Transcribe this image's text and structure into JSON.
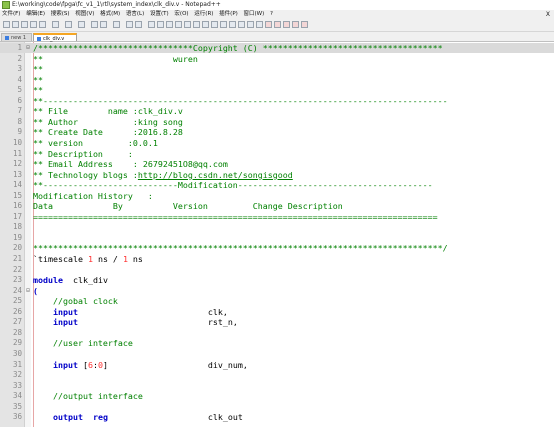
{
  "window": {
    "title": "E:\\working\\code\\fpga\\fc_v1_1\\rtl\\system_index\\clk_div.v - Notepad++",
    "close_glyph": "X"
  },
  "menu": [
    "文件(F)",
    "编辑(E)",
    "搜索(S)",
    "视图(V)",
    "格式(M)",
    "语言(L)",
    "设置(T)",
    "宏(O)",
    "运行(R)",
    "插件(P)",
    "窗口(W)",
    "?"
  ],
  "tabs": [
    {
      "label": "new 1"
    },
    {
      "label": "clk_div.v"
    }
  ],
  "toolbar_icons": [
    "new-file-icon",
    "open-file-icon",
    "save-icon",
    "save-all-icon",
    "close-icon",
    "close-all-icon",
    "print-icon",
    "cut-icon",
    "copy-icon",
    "paste-icon",
    "undo-icon",
    "redo-icon",
    "find-icon",
    "replace-icon",
    "zoom-in-icon",
    "zoom-out-icon",
    "sync-v-icon",
    "sync-h-icon",
    "wrap-icon",
    "show-all-icon",
    "indent-guide-icon",
    "udl-icon",
    "doc-map-icon",
    "function-list-icon",
    "folder-workspace-icon",
    "monitor-icon",
    "record-macro-icon",
    "stop-macro-icon",
    "play-macro-icon",
    "run-macro-icon",
    "save-macro-icon"
  ],
  "lines": [
    {
      "n": "1",
      "fold": "⊟",
      "tokens": [
        {
          "t": "/*******************************Copyright (C) ************************************",
          "c": "c"
        }
      ]
    },
    {
      "n": "2",
      "tokens": [
        {
          "t": "**                          wuren",
          "c": "c"
        }
      ]
    },
    {
      "n": "3",
      "tokens": [
        {
          "t": "**",
          "c": "c"
        }
      ]
    },
    {
      "n": "4",
      "tokens": [
        {
          "t": "**",
          "c": "c"
        }
      ]
    },
    {
      "n": "5",
      "tokens": [
        {
          "t": "**",
          "c": "c"
        }
      ]
    },
    {
      "n": "6",
      "tokens": [
        {
          "t": "**---------------------------------------------------------------------------------",
          "c": "c"
        }
      ]
    },
    {
      "n": "7",
      "tokens": [
        {
          "t": "** File        name :clk_div.v",
          "c": "c"
        }
      ]
    },
    {
      "n": "8",
      "tokens": [
        {
          "t": "** Author           :king song",
          "c": "c"
        }
      ]
    },
    {
      "n": "9",
      "tokens": [
        {
          "t": "** Create Date      :2016.8.28",
          "c": "c"
        }
      ]
    },
    {
      "n": "10",
      "tokens": [
        {
          "t": "** version         :0.0.1",
          "c": "c"
        }
      ]
    },
    {
      "n": "11",
      "tokens": [
        {
          "t": "** Description     :",
          "c": "c"
        }
      ]
    },
    {
      "n": "12",
      "tokens": [
        {
          "t": "** Email Address    : 26792451O8@qq.com",
          "c": "c"
        }
      ]
    },
    {
      "n": "13",
      "tokens": [
        {
          "t": "** Technology blogs :",
          "c": "c"
        },
        {
          "t": "http://blog.csdn.net/songisgood",
          "c": "c u"
        }
      ]
    },
    {
      "n": "14",
      "tokens": [
        {
          "t": "**---------------------------Modification---------------------------------------",
          "c": "c"
        }
      ]
    },
    {
      "n": "15",
      "tokens": [
        {
          "t": "Modification History   :",
          "c": "c"
        }
      ]
    },
    {
      "n": "16",
      "tokens": [
        {
          "t": "Data            By          Version         Change Description",
          "c": "c"
        }
      ]
    },
    {
      "n": "17",
      "tokens": [
        {
          "t": "=================================================================================",
          "c": "c"
        }
      ]
    },
    {
      "n": "18",
      "tokens": []
    },
    {
      "n": "19",
      "tokens": []
    },
    {
      "n": "20",
      "tokens": [
        {
          "t": "**********************************************************************************/",
          "c": "c"
        }
      ]
    },
    {
      "n": "21",
      "tokens": [
        {
          "t": "`timescale ",
          "c": "o"
        },
        {
          "t": "1",
          "c": "n"
        },
        {
          "t": " ns / ",
          "c": "o"
        },
        {
          "t": "1",
          "c": "n"
        },
        {
          "t": " ns",
          "c": "o"
        }
      ]
    },
    {
      "n": "22",
      "tokens": []
    },
    {
      "n": "23",
      "tokens": [
        {
          "t": "module",
          "c": "k"
        },
        {
          "t": "  clk_div",
          "c": "o"
        }
      ]
    },
    {
      "n": "24",
      "fold": "⊟",
      "tokens": [
        {
          "t": "(",
          "c": "k"
        }
      ]
    },
    {
      "n": "25",
      "tokens": [
        {
          "t": "    //gobal clock",
          "c": "c"
        }
      ]
    },
    {
      "n": "26",
      "tokens": [
        {
          "t": "    ",
          "c": "o"
        },
        {
          "t": "input",
          "c": "k"
        },
        {
          "t": "                          clk,",
          "c": "o"
        }
      ]
    },
    {
      "n": "27",
      "tokens": [
        {
          "t": "    ",
          "c": "o"
        },
        {
          "t": "input",
          "c": "k"
        },
        {
          "t": "                          rst_n,",
          "c": "o"
        }
      ]
    },
    {
      "n": "28",
      "tokens": []
    },
    {
      "n": "29",
      "tokens": [
        {
          "t": "    //user interface",
          "c": "c"
        }
      ]
    },
    {
      "n": "30",
      "tokens": []
    },
    {
      "n": "31",
      "tokens": [
        {
          "t": "    ",
          "c": "o"
        },
        {
          "t": "input",
          "c": "k"
        },
        {
          "t": " [",
          "c": "o"
        },
        {
          "t": "6",
          "c": "n"
        },
        {
          "t": ":",
          "c": "o"
        },
        {
          "t": "0",
          "c": "n"
        },
        {
          "t": "]",
          "c": "o"
        },
        {
          "t": "                    div_num,",
          "c": "o"
        }
      ]
    },
    {
      "n": "32",
      "tokens": []
    },
    {
      "n": "33",
      "tokens": []
    },
    {
      "n": "34",
      "tokens": [
        {
          "t": "    //output interface",
          "c": "c"
        }
      ]
    },
    {
      "n": "35",
      "tokens": []
    },
    {
      "n": "36",
      "tokens": [
        {
          "t": "    ",
          "c": "o"
        },
        {
          "t": "output",
          "c": "k"
        },
        {
          "t": "  ",
          "c": "o"
        },
        {
          "t": "reg",
          "c": "k"
        },
        {
          "t": "                    clk_out",
          "c": "o"
        }
      ]
    }
  ]
}
